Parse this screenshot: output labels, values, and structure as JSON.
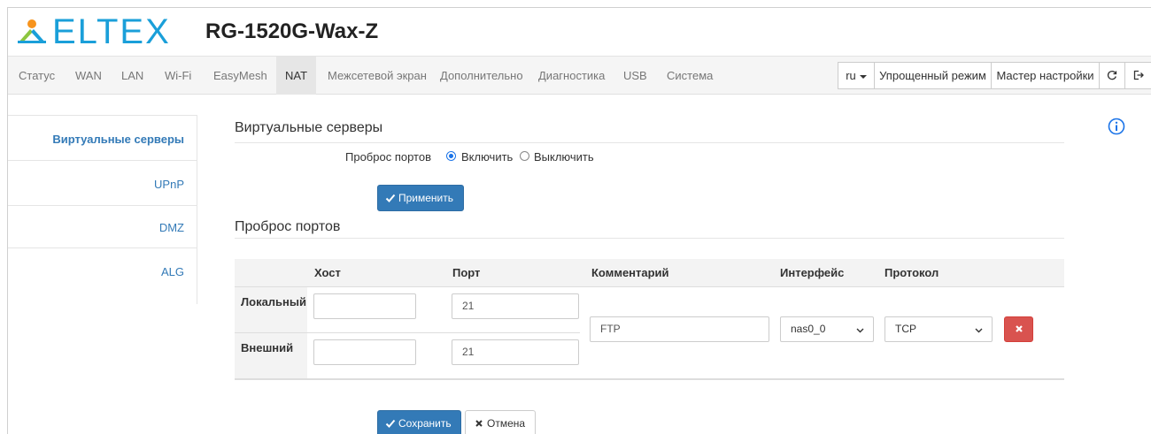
{
  "brand": {
    "logo_text": "ELTEX",
    "model": "RG-1520G-Wax-Z",
    "accent_color": "#1a9fd9"
  },
  "nav": {
    "items": [
      {
        "label": "Статус"
      },
      {
        "label": "WAN"
      },
      {
        "label": "LAN"
      },
      {
        "label": "Wi-Fi"
      },
      {
        "label": "EasyMesh"
      },
      {
        "label": "NAT",
        "active": true
      },
      {
        "label": "Межсетевой экран"
      },
      {
        "label": "Дополнительно"
      },
      {
        "label": "Диагностика"
      },
      {
        "label": "USB"
      },
      {
        "label": "Система"
      }
    ],
    "language": "ru",
    "simple_mode": "Упрощенный режим",
    "wizard": "Мастер настройки",
    "refresh_icon": "refresh-icon",
    "logout_icon": "logout-icon"
  },
  "sidebar": {
    "items": [
      {
        "label": "Виртуальные серверы",
        "active": true
      },
      {
        "label": "UPnP"
      },
      {
        "label": "DMZ"
      },
      {
        "label": "ALG"
      }
    ]
  },
  "virtual_servers": {
    "title": "Виртуальные серверы",
    "port_forwarding_label": "Проброс портов",
    "enable_label": "Включить",
    "disable_label": "Выключить",
    "selected": "enable",
    "apply_label": "Применить"
  },
  "port_forwarding": {
    "title": "Проброс портов",
    "columns": [
      "Хост",
      "Порт",
      "Комментарий",
      "Интерфейс",
      "Протокол"
    ],
    "rows": [
      {
        "label": "Локальный",
        "host": "",
        "port": "21"
      },
      {
        "label": "Внешний",
        "host": "",
        "port": "21"
      }
    ],
    "comment": "FTP",
    "interface": "nas0_0",
    "protocol": "TCP"
  },
  "footer": {
    "save_label": "Сохранить",
    "cancel_label": "Отмена"
  },
  "colors": {
    "primary": "#337ab7",
    "danger": "#d9534f"
  }
}
